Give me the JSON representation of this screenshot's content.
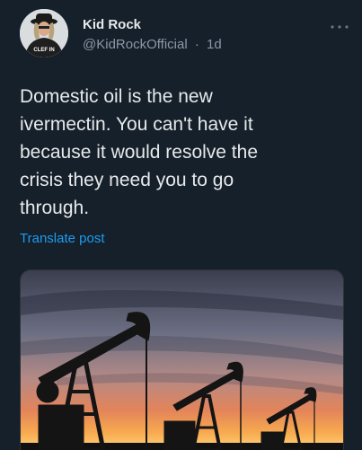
{
  "tweet": {
    "author_name": "Kid Rock",
    "author_handle": "@KidRockOfficial",
    "separator": "·",
    "time_ago": "1d",
    "more_icon": "more-horizontal-icon",
    "text": "Domestic oil is the new\nivermectin. You can't have it\nbecause it would resolve the\ncrisis they need you to go\nthrough.",
    "translate_label": "Translate post",
    "avatar_shirt_text": "CLEF IN"
  },
  "colors": {
    "background": "#15202b",
    "text_primary": "#e7e9ea",
    "text_secondary": "#8b98a5",
    "link": "#1d9bf0"
  }
}
